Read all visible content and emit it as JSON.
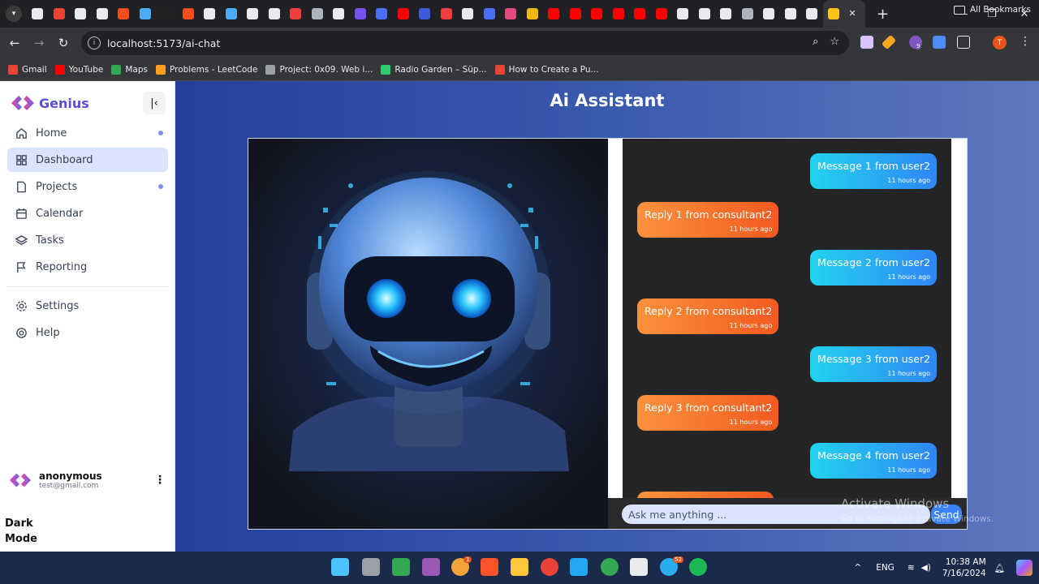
{
  "browser": {
    "tab_colors": [
      "#e8eaed",
      "#ea4335",
      "#e8eaed",
      "#e8eaed",
      "#f24e1e",
      "#4dabf7",
      "#222222",
      "#f24e1e",
      "#e8eaed",
      "#4dabf7",
      "#e8eaed",
      "#e8eaed",
      "#f03e3e",
      "#adb5bd",
      "#e8eaed",
      "#7950f2",
      "#4c6ef5",
      "#ff0000",
      "#3b5bdb",
      "#f03e3e",
      "#e8eaed",
      "#4c6ef5",
      "#e64980",
      "#f0b90b",
      "#ff0000",
      "#ff0000",
      "#ff0000",
      "#ff0000",
      "#ff0000",
      "#ff0000",
      "#e8eaed",
      "#e8eaed",
      "#e8eaed",
      "#adb5bd",
      "#e8eaed",
      "#e8eaed",
      "#e8eaed",
      "#fcc419"
    ],
    "url": "localhost:5173/ai-chat",
    "profile_initial": "T",
    "extension_badge": "9",
    "bookmarks": [
      {
        "label": "Gmail",
        "color": "#ea4335"
      },
      {
        "label": "YouTube",
        "color": "#ff0000"
      },
      {
        "label": "Maps",
        "color": "#34a853"
      },
      {
        "label": "Problems - LeetCode",
        "color": "#f89f1b"
      },
      {
        "label": "Project: 0x09. Web i...",
        "color": "#9aa0a6"
      },
      {
        "label": "Radio Garden – Süp...",
        "color": "#2ecc71"
      },
      {
        "label": "How to Create a Pu...",
        "color": "#ea4335"
      }
    ],
    "all_bookmarks": "All Bookmarks"
  },
  "sidebar": {
    "brand": "Genius",
    "nav": [
      {
        "label": "Home",
        "icon": "home-icon",
        "dot": true,
        "active": false
      },
      {
        "label": "Dashboard",
        "icon": "dashboard-icon",
        "dot": false,
        "active": true
      },
      {
        "label": "Projects",
        "icon": "file-icon",
        "dot": true,
        "active": false
      },
      {
        "label": "Calendar",
        "icon": "calendar-icon",
        "dot": false,
        "active": false
      },
      {
        "label": "Tasks",
        "icon": "layers-icon",
        "dot": false,
        "active": false
      },
      {
        "label": "Reporting",
        "icon": "flag-icon",
        "dot": false,
        "active": false
      }
    ],
    "footer_nav": [
      {
        "label": "Settings",
        "icon": "gear-icon"
      },
      {
        "label": "Help",
        "icon": "help-icon"
      }
    ],
    "user": {
      "name": "anonymous",
      "email": "test@gmail.com"
    },
    "dark_mode": "Dark Mode"
  },
  "main": {
    "title": "Ai Assistant",
    "messages": [
      {
        "role": "user",
        "text": "Message 1 from user2",
        "time": "11 hours ago"
      },
      {
        "role": "bot",
        "text": "Reply 1 from consultant2",
        "time": "11 hours ago"
      },
      {
        "role": "user",
        "text": "Message 2 from user2",
        "time": "11 hours ago"
      },
      {
        "role": "bot",
        "text": "Reply 2 from consultant2",
        "time": "11 hours ago"
      },
      {
        "role": "user",
        "text": "Message 3 from user2",
        "time": "11 hours ago"
      },
      {
        "role": "bot",
        "text": "Reply 3 from consultant2",
        "time": "11 hours ago"
      },
      {
        "role": "user",
        "text": "Message 4 from user2",
        "time": "11 hours ago"
      },
      {
        "role": "bot",
        "text": "",
        "time": ""
      }
    ],
    "input_placeholder": "Ask me anything ...",
    "send_label": "Send"
  },
  "overlay": {
    "activate_title": "Activate Windows",
    "activate_sub": "Go to Settings to activate Windows."
  },
  "taskbar": {
    "apps": [
      "windows-start-icon",
      "file-explorer-icon",
      "photos-icon",
      "git-icon",
      "chrome-icon",
      "brave-icon",
      "folder-icon",
      "chrome-icon",
      "vscode-icon",
      "chrome-icon",
      "browser-icon",
      "telegram-icon",
      "spotify-icon"
    ],
    "app_colors": [
      "#4cc2ff",
      "#9aa0a6",
      "#34a853",
      "#9b59b6",
      "#f2a33a",
      "#fb542b",
      "#ffc83d",
      "#ea4335",
      "#23a9f2",
      "#34a853",
      "#e8eaed",
      "#2aabee",
      "#1db954"
    ],
    "chrome_badge": "1",
    "telegram_badge": "52",
    "language": "ENG",
    "time": "10:38 AM",
    "date": "7/16/2024"
  }
}
